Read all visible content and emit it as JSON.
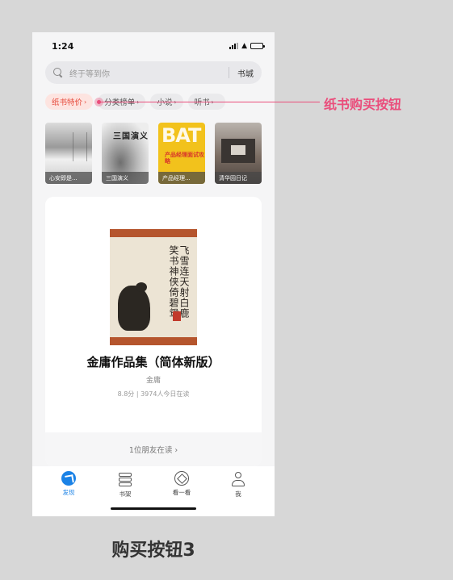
{
  "status_bar": {
    "time": "1:24"
  },
  "search": {
    "placeholder": "终于等到你",
    "store_label": "书城"
  },
  "chips": [
    {
      "label": "纸书特价",
      "active": true
    },
    {
      "label": "分类榜单"
    },
    {
      "label": "小说"
    },
    {
      "label": "听书"
    }
  ],
  "books": [
    {
      "title": "心安即是..."
    },
    {
      "title": "三国演义",
      "cover_text": "三国演义"
    },
    {
      "title": "产品经理...",
      "cover_text": "BAT",
      "cover_subtitle": "产品经理面试攻略"
    },
    {
      "title": "清华园日记"
    }
  ],
  "featured": {
    "title": "金庸作品集（简体新版）",
    "author": "金庸",
    "meta": "8.8分 | 3974人今日在读",
    "friends": "1位朋友在读 ›",
    "cover_calligraphy": "飞雪连天射白鹿笑书神侠倚碧鸳"
  },
  "tabbar": [
    {
      "label": "发现",
      "icon": "discover-icon",
      "active": true
    },
    {
      "label": "书架",
      "icon": "bookshelf-icon"
    },
    {
      "label": "看一看",
      "icon": "look-icon"
    },
    {
      "label": "我",
      "icon": "profile-icon"
    }
  ],
  "annotation": {
    "label": "纸书购买按钮"
  },
  "caption": "购买按钮3",
  "colors": {
    "accent": "#1a82e6",
    "annotation": "#ea4d7b",
    "chip_active_bg": "#fde4e0",
    "chip_active_text": "#e64a3b"
  }
}
